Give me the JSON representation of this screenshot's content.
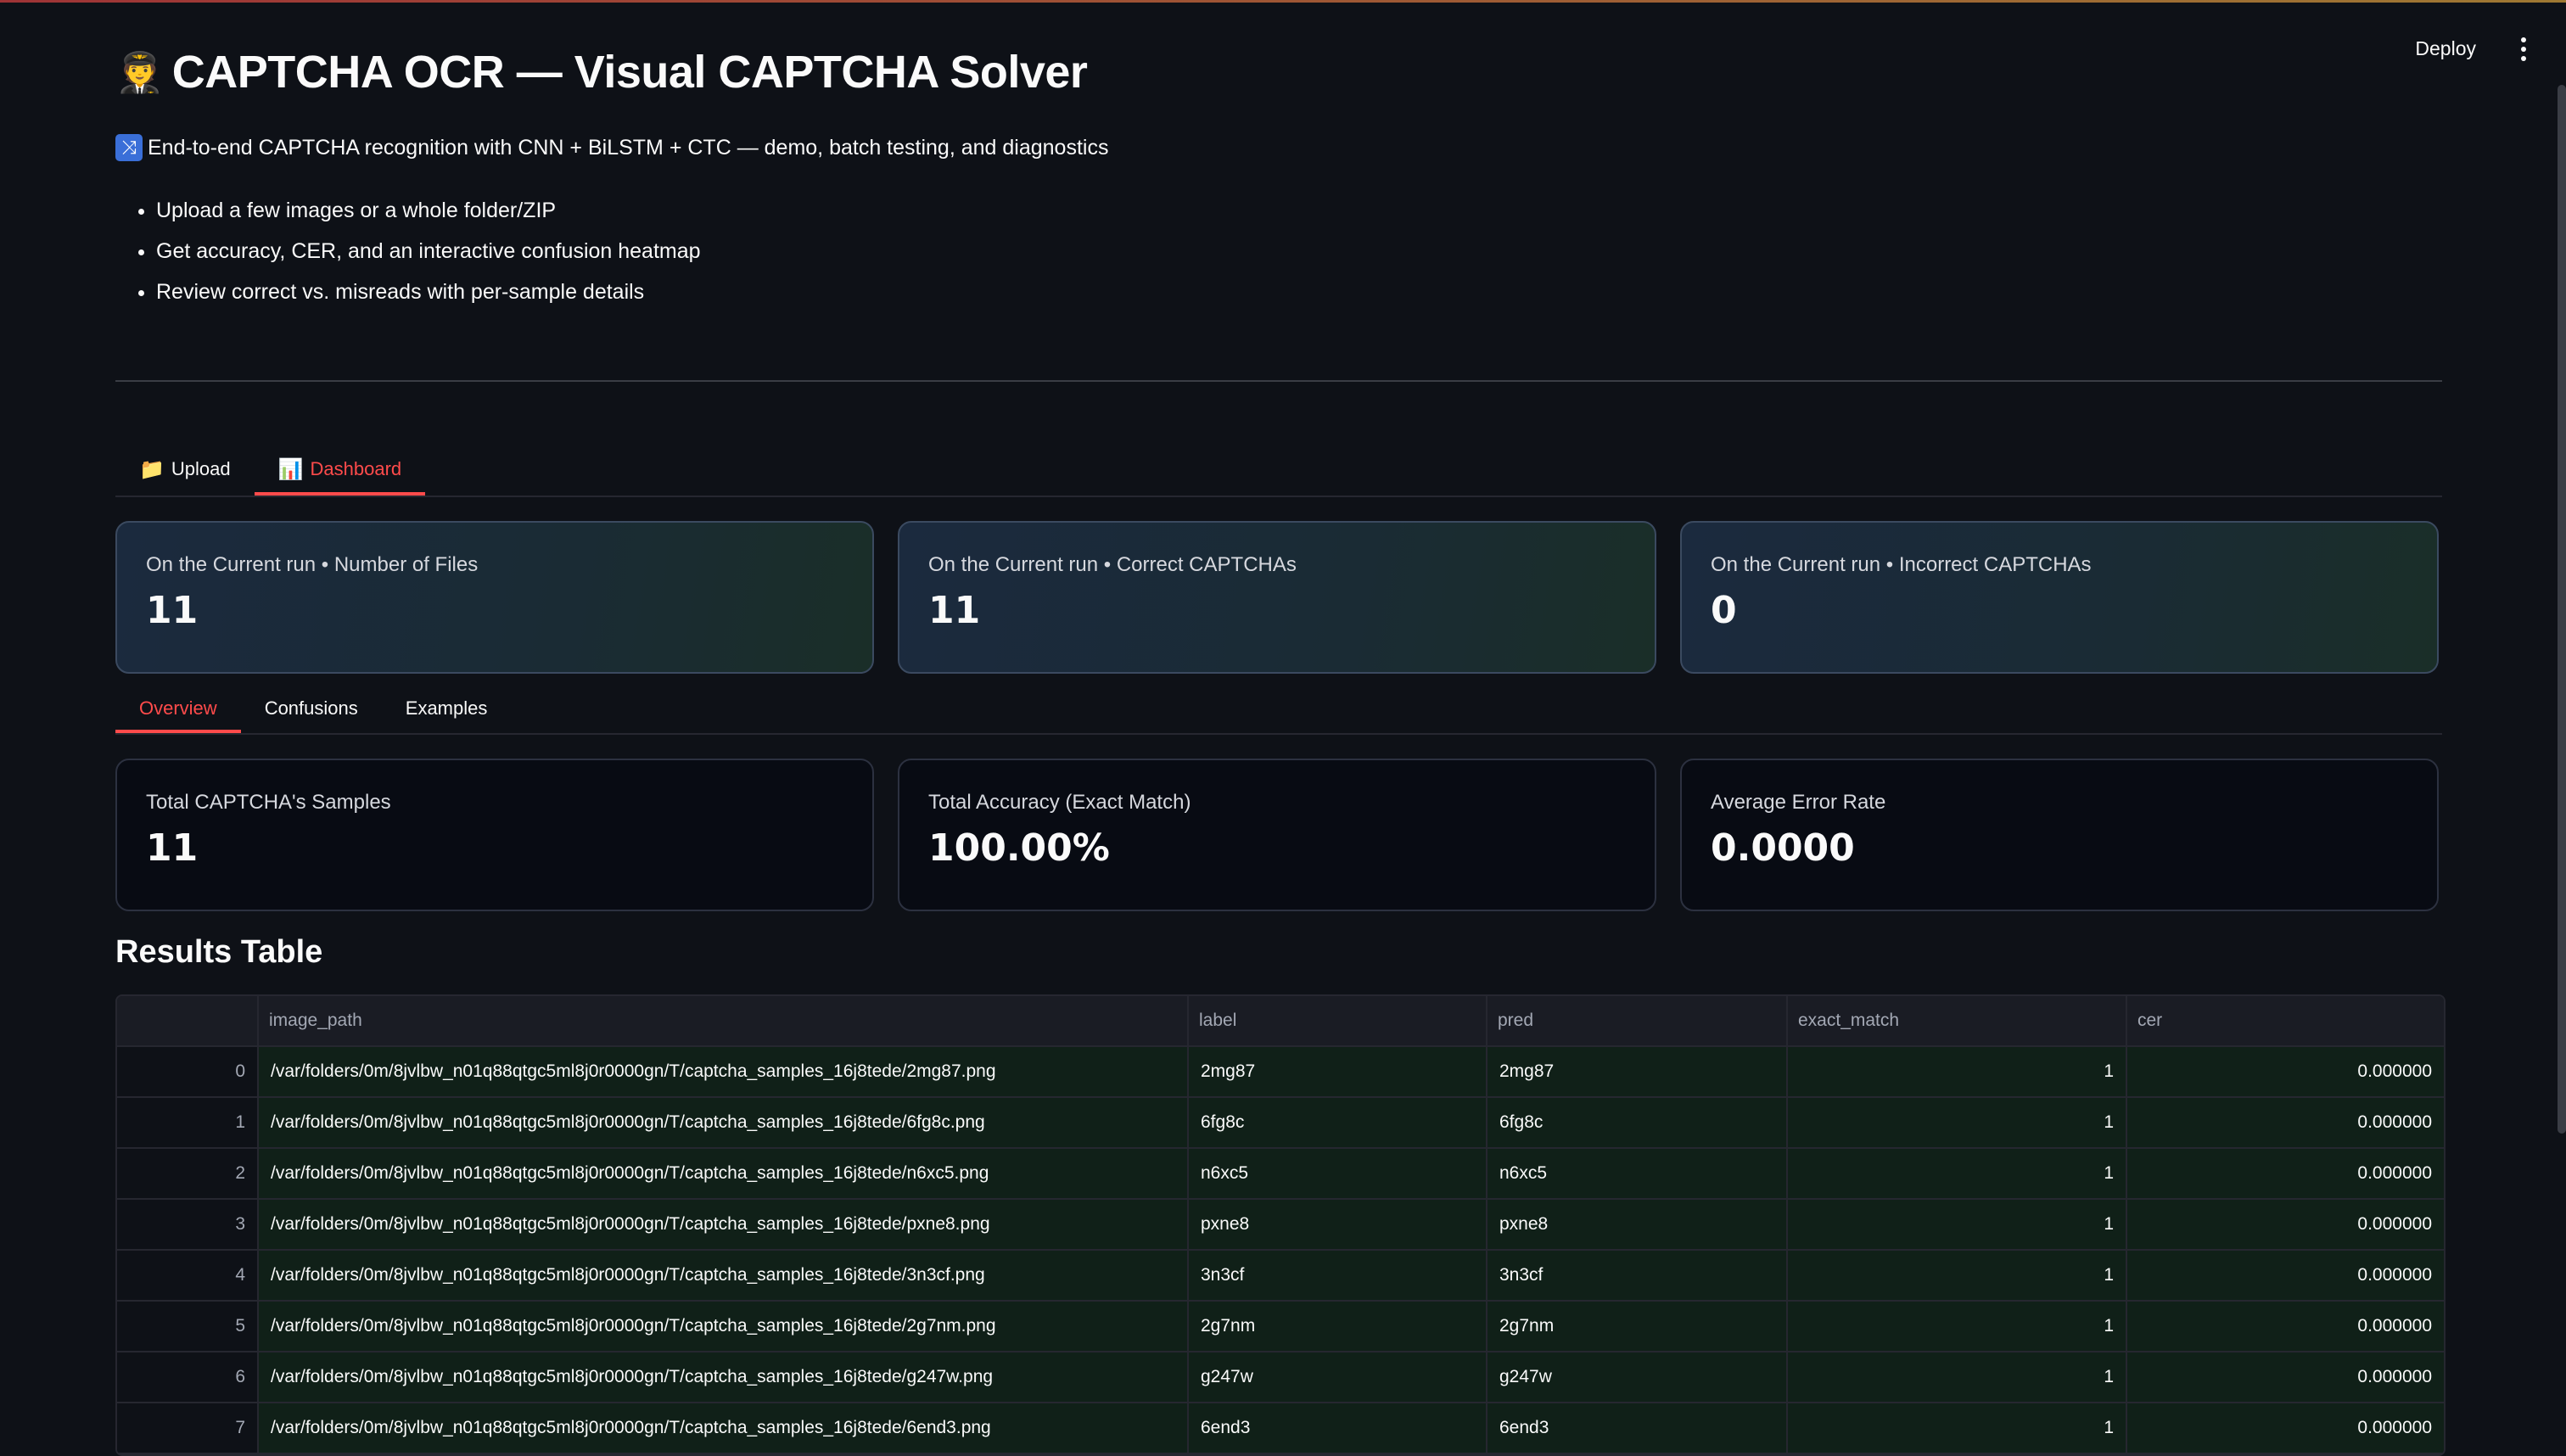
{
  "app": {
    "title_emoji": "🧑‍✈️",
    "title": "CAPTCHA OCR — Visual CAPTCHA Solver",
    "subtitle_icon": "shuffle-icon",
    "subtitle": "End-to-end CAPTCHA recognition with CNN + BiLSTM + CTC — demo, batch testing, and diagnostics",
    "features": [
      "Upload a few images or a whole folder/ZIP",
      "Get accuracy, CER, and an interactive confusion heatmap",
      "Review correct vs. misreads with per-sample details"
    ]
  },
  "toolbar": {
    "deploy_label": "Deploy",
    "menu_icon": "kebab-menu-icon"
  },
  "tabs": [
    {
      "icon": "📁",
      "label": "Upload",
      "active": false
    },
    {
      "icon": "📊",
      "label": "Dashboard",
      "active": true
    }
  ],
  "summary_cards": [
    {
      "label": "On the Current run • Number of Files",
      "value": "11"
    },
    {
      "label": "On the Current run • Correct CAPTCHAs",
      "value": "11"
    },
    {
      "label": "On the Current run • Incorrect CAPTCHAs",
      "value": "0"
    }
  ],
  "subtabs": [
    {
      "label": "Overview",
      "active": true
    },
    {
      "label": "Confusions",
      "active": false
    },
    {
      "label": "Examples",
      "active": false
    }
  ],
  "metrics": [
    {
      "label": "Total CAPTCHA's Samples",
      "value": "11"
    },
    {
      "label": "Total Accuracy (Exact Match)",
      "value": "100.00%"
    },
    {
      "label": "Average Error Rate",
      "value": "0.0000"
    }
  ],
  "results": {
    "heading": "Results Table",
    "columns": [
      "",
      "image_path",
      "label",
      "pred",
      "exact_match",
      "cer"
    ],
    "rows": [
      [
        "0",
        "/var/folders/0m/8jvlbw_n01q88qtgc5ml8j0r0000gn/T/captcha_samples_16j8tede/2mg87.png",
        "2mg87",
        "2mg87",
        "1",
        "0.000000"
      ],
      [
        "1",
        "/var/folders/0m/8jvlbw_n01q88qtgc5ml8j0r0000gn/T/captcha_samples_16j8tede/6fg8c.png",
        "6fg8c",
        "6fg8c",
        "1",
        "0.000000"
      ],
      [
        "2",
        "/var/folders/0m/8jvlbw_n01q88qtgc5ml8j0r0000gn/T/captcha_samples_16j8tede/n6xc5.png",
        "n6xc5",
        "n6xc5",
        "1",
        "0.000000"
      ],
      [
        "3",
        "/var/folders/0m/8jvlbw_n01q88qtgc5ml8j0r0000gn/T/captcha_samples_16j8tede/pxne8.png",
        "pxne8",
        "pxne8",
        "1",
        "0.000000"
      ],
      [
        "4",
        "/var/folders/0m/8jvlbw_n01q88qtgc5ml8j0r0000gn/T/captcha_samples_16j8tede/3n3cf.png",
        "3n3cf",
        "3n3cf",
        "1",
        "0.000000"
      ],
      [
        "5",
        "/var/folders/0m/8jvlbw_n01q88qtgc5ml8j0r0000gn/T/captcha_samples_16j8tede/2g7nm.png",
        "2g7nm",
        "2g7nm",
        "1",
        "0.000000"
      ],
      [
        "6",
        "/var/folders/0m/8jvlbw_n01q88qtgc5ml8j0r0000gn/T/captcha_samples_16j8tede/g247w.png",
        "g247w",
        "g247w",
        "1",
        "0.000000"
      ],
      [
        "7",
        "/var/folders/0m/8jvlbw_n01q88qtgc5ml8j0r0000gn/T/captcha_samples_16j8tede/6end3.png",
        "6end3",
        "6end3",
        "1",
        "0.000000"
      ]
    ]
  },
  "colors": {
    "accent": "#ff4b4b",
    "background": "#0e1117",
    "row_match_bg": "#102018"
  }
}
